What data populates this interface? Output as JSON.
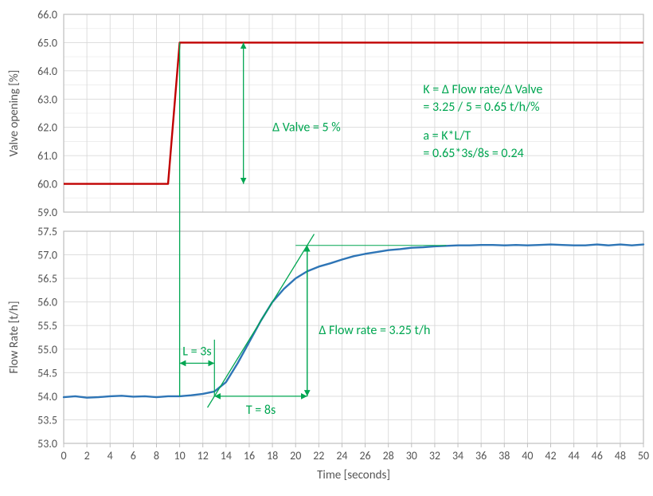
{
  "chart_data": [
    {
      "type": "line",
      "name": "Valve opening step input",
      "title": "",
      "xlabel": "Time [seconds]",
      "ylabel": "Valve opening [%]",
      "xlim": [
        0,
        50
      ],
      "ylim": [
        59.0,
        66.0
      ],
      "x": [
        0,
        1,
        2,
        3,
        4,
        5,
        6,
        7,
        8,
        9,
        10,
        11,
        12,
        13,
        14,
        15,
        16,
        17,
        18,
        19,
        20,
        21,
        22,
        23,
        24,
        25,
        26,
        27,
        28,
        29,
        30,
        31,
        32,
        33,
        34,
        35,
        36,
        37,
        38,
        39,
        40,
        41,
        42,
        43,
        44,
        45,
        46,
        47,
        48,
        49,
        50
      ],
      "values": [
        60.0,
        60.0,
        60.0,
        60.0,
        60.0,
        60.0,
        60.0,
        60.0,
        60.0,
        60.0,
        65.0,
        65.0,
        65.0,
        65.0,
        65.0,
        65.0,
        65.0,
        65.0,
        65.0,
        65.0,
        65.0,
        65.0,
        65.0,
        65.0,
        65.0,
        65.0,
        65.0,
        65.0,
        65.0,
        65.0,
        65.0,
        65.0,
        65.0,
        65.0,
        65.0,
        65.0,
        65.0,
        65.0,
        65.0,
        65.0,
        65.0,
        65.0,
        65.0,
        65.0,
        65.0,
        65.0,
        65.0,
        65.0,
        65.0,
        65.0,
        65.0
      ],
      "y_ticks": [
        59.0,
        60.0,
        61.0,
        62.0,
        63.0,
        64.0,
        65.0,
        66.0
      ],
      "grid": true,
      "annotations": {
        "delta_valve": "Δ Valve = 5 %"
      }
    },
    {
      "type": "line",
      "name": "Flow rate response",
      "title": "",
      "xlabel": "Time [seconds]",
      "ylabel": "Flow Rate [t/h]",
      "xlim": [
        0,
        50
      ],
      "ylim": [
        53.0,
        57.5
      ],
      "x": [
        0,
        1,
        2,
        3,
        4,
        5,
        6,
        7,
        8,
        9,
        10,
        11,
        12,
        13,
        14,
        15,
        16,
        17,
        18,
        19,
        20,
        21,
        22,
        23,
        24,
        25,
        26,
        27,
        28,
        29,
        30,
        31,
        32,
        33,
        34,
        35,
        36,
        37,
        38,
        39,
        40,
        41,
        42,
        43,
        44,
        45,
        46,
        47,
        48,
        49,
        50
      ],
      "values": [
        53.98,
        54.0,
        53.97,
        53.98,
        54.0,
        54.01,
        53.99,
        54.0,
        53.98,
        54.0,
        54.0,
        54.02,
        54.05,
        54.1,
        54.3,
        54.7,
        55.15,
        55.6,
        56.0,
        56.28,
        56.5,
        56.65,
        56.75,
        56.82,
        56.9,
        56.97,
        57.02,
        57.06,
        57.1,
        57.12,
        57.15,
        57.16,
        57.18,
        57.19,
        57.2,
        57.2,
        57.21,
        57.21,
        57.2,
        57.21,
        57.2,
        57.21,
        57.22,
        57.21,
        57.2,
        57.2,
        57.22,
        57.2,
        57.22,
        57.2,
        57.22
      ],
      "y_ticks": [
        53.0,
        53.5,
        54.0,
        54.5,
        55.0,
        55.5,
        56.0,
        56.5,
        57.0,
        57.5
      ],
      "x_ticks": [
        0,
        2,
        4,
        6,
        8,
        10,
        12,
        14,
        16,
        18,
        20,
        22,
        24,
        26,
        28,
        30,
        32,
        34,
        36,
        38,
        40,
        42,
        44,
        46,
        48,
        50
      ],
      "grid": true,
      "annotations": {
        "L": "L = 3s",
        "T": "T = 8s",
        "delta_flow": "Δ Flow rate = 3.25 t/h"
      }
    }
  ],
  "annot": {
    "delta_valve": "Δ Valve = 5 %",
    "k_line1": "K = Δ Flow rate/Δ Valve",
    "k_line2": "    = 3.25 / 5 = 0.65 t/h/%",
    "a_line1": "a = K*L/T",
    "a_line2": "    = 0.65*3s/8s = 0.24",
    "L": "L = 3s",
    "T": "T = 8s",
    "delta_flow": "Δ Flow rate = 3.25 t/h"
  },
  "labels": {
    "y1": "Valve opening [%]",
    "y2": "Flow Rate [t/h]",
    "x": "Time [seconds]"
  },
  "y1_ticks": [
    "59.0",
    "60.0",
    "61.0",
    "62.0",
    "63.0",
    "64.0",
    "65.0",
    "66.0"
  ],
  "y2_ticks": [
    "53.0",
    "53.5",
    "54.0",
    "54.5",
    "55.0",
    "55.5",
    "56.0",
    "56.5",
    "57.0",
    "57.5"
  ],
  "x_ticks": [
    "0",
    "2",
    "4",
    "6",
    "8",
    "10",
    "12",
    "14",
    "16",
    "18",
    "20",
    "22",
    "24",
    "26",
    "28",
    "30",
    "32",
    "34",
    "36",
    "38",
    "40",
    "42",
    "44",
    "46",
    "48",
    "50"
  ]
}
